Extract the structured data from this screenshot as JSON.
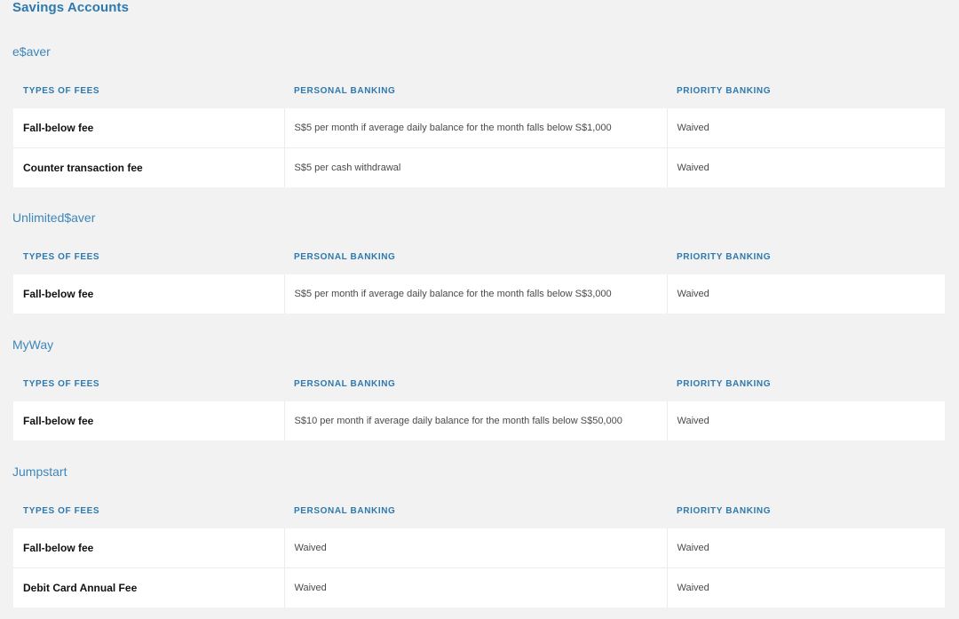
{
  "page": {
    "title": "Savings Accounts"
  },
  "colors": {
    "accent": "#2e79ad",
    "section_title": "#3d86b8",
    "background": "#f2f2f3",
    "row_background": "#ffffff"
  },
  "headers": {
    "types_of_fees": "TYPES OF FEES",
    "personal_banking": "PERSONAL BANKING",
    "priority_banking": "PRIORITY BANKING"
  },
  "sections": [
    {
      "title": "e$aver",
      "rows": [
        {
          "fee": "Fall-below fee",
          "personal": "S$5 per month if average daily balance for the month falls below S$1,000",
          "priority": "Waived"
        },
        {
          "fee": "Counter transaction fee",
          "personal": "S$5 per cash withdrawal",
          "priority": "Waived"
        }
      ]
    },
    {
      "title": "Unlimited$aver",
      "rows": [
        {
          "fee": "Fall-below fee",
          "personal": "S$5 per month if average daily balance for the month falls below S$3,000",
          "priority": "Waived"
        }
      ]
    },
    {
      "title": "MyWay",
      "rows": [
        {
          "fee": "Fall-below fee",
          "personal": "S$10 per month if average daily balance for the month falls below S$50,000",
          "priority": "Waived"
        }
      ]
    },
    {
      "title": "Jumpstart",
      "rows": [
        {
          "fee": "Fall-below fee",
          "personal": "Waived",
          "priority": "Waived"
        },
        {
          "fee": "Debit Card Annual Fee",
          "personal": "Waived",
          "priority": "Waived"
        }
      ]
    }
  ]
}
